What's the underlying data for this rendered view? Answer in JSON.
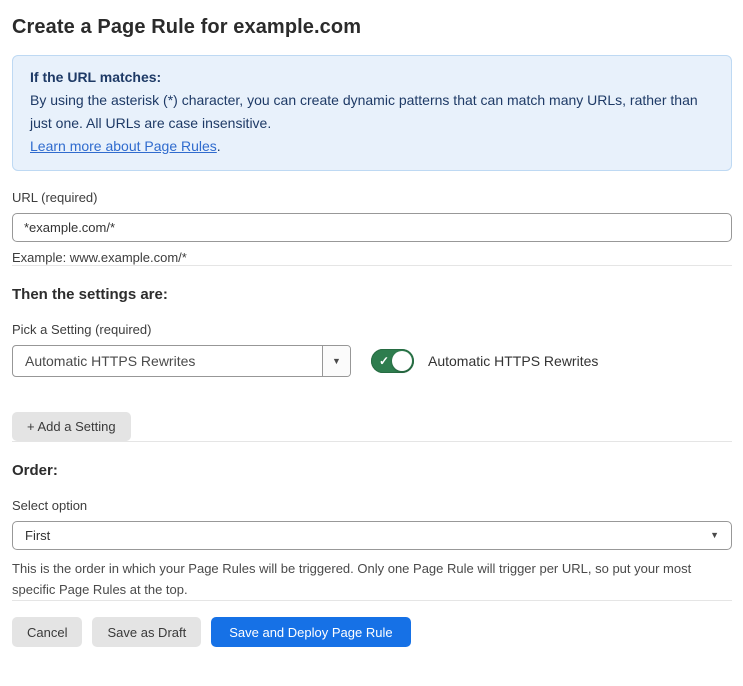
{
  "page": {
    "title": "Create a Page Rule for example.com"
  },
  "info_box": {
    "heading": "If the URL matches:",
    "body": "By using the asterisk (*) character, you can create dynamic patterns that can match many URLs, rather than just one. All URLs are case insensitive.",
    "link_label": "Learn more about Page Rules",
    "link_suffix": "."
  },
  "url_field": {
    "label": "URL (required)",
    "value": "*example.com/*",
    "example": "Example: www.example.com/*"
  },
  "settings_section": {
    "heading": "Then the settings are:",
    "picker_label": "Pick a Setting (required)",
    "picker_value": "Automatic HTTPS Rewrites",
    "toggle_state": "on",
    "toggle_label": "Automatic HTTPS Rewrites",
    "add_setting_label": "+ Add a Setting"
  },
  "order_section": {
    "heading": "Order:",
    "select_label": "Select option",
    "select_value": "First",
    "help_text": "This is the order in which your Page Rules will be triggered. Only one Page Rule will trigger per URL, so put your most specific Page Rules at the top."
  },
  "footer": {
    "cancel_label": "Cancel",
    "save_draft_label": "Save as Draft",
    "save_deploy_label": "Save and Deploy Page Rule"
  },
  "icons": {
    "dropdown_arrow": "▼",
    "check": "✓"
  },
  "colors": {
    "accent_blue": "#1671e6",
    "toggle_green": "#2e7d4e",
    "info_background": "#e8f1fb",
    "info_border": "#bed9f3",
    "info_text": "#1e3a66",
    "link_blue": "#2f6bce"
  }
}
